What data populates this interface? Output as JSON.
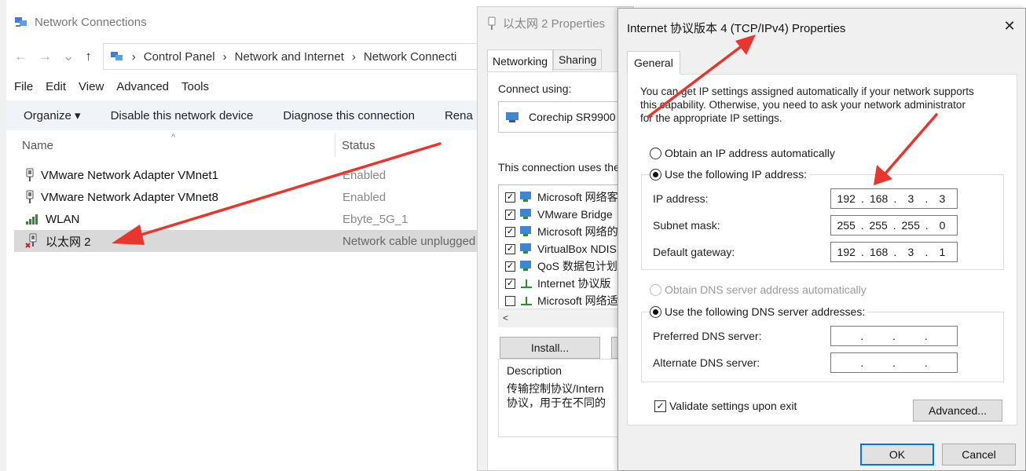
{
  "explorer": {
    "title": "Network Connections",
    "address": {
      "back_glyph": "←",
      "forward_glyph": "→",
      "recent_glyph": "⌄",
      "up_glyph": "↑",
      "crumbs": [
        "Control Panel",
        "Network and Internet",
        "Network Connecti"
      ]
    },
    "menu": [
      "File",
      "Edit",
      "View",
      "Advanced",
      "Tools"
    ],
    "toolbar": {
      "organize": "Organize ▾",
      "disable": "Disable this network device",
      "diagnose": "Diagnose this connection",
      "rename": "Rena"
    },
    "columns": {
      "name": "Name",
      "status": "Status",
      "sort_glyph": "^"
    },
    "rows": [
      {
        "name": "VMware Network Adapter VMnet1",
        "status": "Enabled",
        "icon": "network-adapter-icon"
      },
      {
        "name": "VMware Network Adapter VMnet8",
        "status": "Enabled",
        "icon": "network-adapter-icon"
      },
      {
        "name": "WLAN",
        "status": "Ebyte_5G_1",
        "icon": "wifi-signal-icon"
      },
      {
        "name": "以太网 2",
        "status": "Network cable unplugged",
        "icon": "unplugged-adapter-icon"
      }
    ]
  },
  "ethernet_props": {
    "title": "以太网 2 Properties",
    "tabs": [
      "Networking",
      "Sharing"
    ],
    "connect_using_label": "Connect using:",
    "adapter": "Corechip SR9900",
    "uses_label": "This connection uses the",
    "items": [
      {
        "label": "Microsoft 网络客",
        "checked": true
      },
      {
        "label": "VMware Bridge",
        "checked": true
      },
      {
        "label": "Microsoft 网络的",
        "checked": true
      },
      {
        "label": "VirtualBox NDIS",
        "checked": true
      },
      {
        "label": "QoS 数据包计划",
        "checked": true
      },
      {
        "label": "Internet 协议版",
        "checked": true
      },
      {
        "label": "Microsoft 网络适",
        "checked": false
      }
    ],
    "scroll_left": "<",
    "install_button": "Install...",
    "description_label": "Description",
    "description_lines": [
      "传输控制协议/Intern",
      "协议，用于在不同的"
    ]
  },
  "ipv4_dialog": {
    "title": "Internet 协议版本 4 (TCP/IPv4) Properties",
    "close_glyph": "✕",
    "tab": "General",
    "intro_lines": [
      "You can get IP settings assigned automatically if your network supports",
      "this capability. Otherwise, you need to ask your network administrator",
      "for the appropriate IP settings."
    ],
    "obtain_ip_auto": "Obtain an IP address automatically",
    "use_following_ip": "Use the following IP address:",
    "ip_label": "IP address:",
    "ip_octets": [
      "192",
      "168",
      "3",
      "3"
    ],
    "subnet_label": "Subnet mask:",
    "subnet_octets": [
      "255",
      "255",
      "255",
      "0"
    ],
    "gateway_label": "Default gateway:",
    "gateway_octets": [
      "192",
      "168",
      "3",
      "1"
    ],
    "obtain_dns_auto": "Obtain DNS server address automatically",
    "use_following_dns": "Use the following DNS server addresses:",
    "preferred_dns_label": "Preferred DNS server:",
    "alternate_dns_label": "Alternate DNS server:",
    "validate_label": "Validate settings upon exit",
    "advanced_button": "Advanced...",
    "ok_button": "OK",
    "cancel_button": "Cancel",
    "dot": "."
  },
  "colors": {
    "annotation_arrow": "#e8362f",
    "selection_bg": "#d9d9d9",
    "toolbar_bg": "#f0f4f9",
    "dialog_bg": "#f0f0f0",
    "default_button_border": "#0078d7"
  }
}
